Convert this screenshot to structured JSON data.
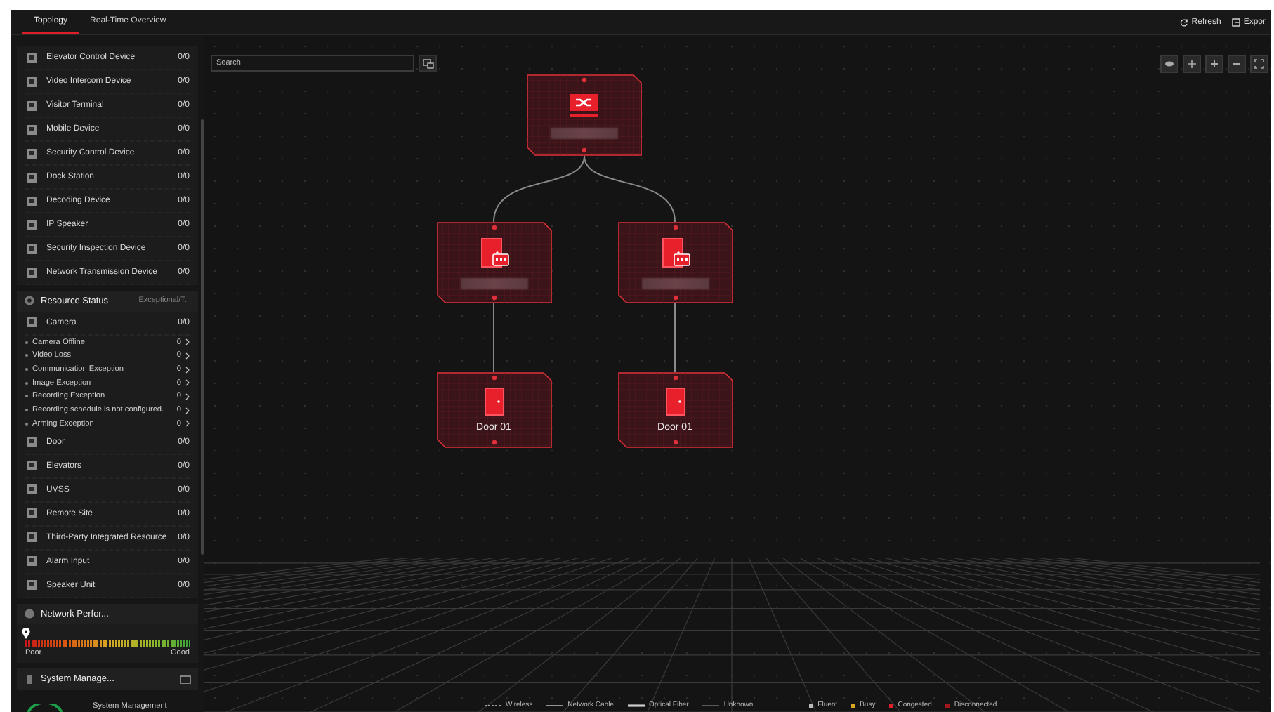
{
  "tabs": [
    {
      "label": "Topology",
      "selected": true
    },
    {
      "label": "Real-Time Overview",
      "selected": false
    }
  ],
  "actions": [
    {
      "kind": "refresh",
      "label": "Refresh"
    },
    {
      "kind": "export",
      "label": "Expor"
    }
  ],
  "device_list": [
    {
      "name": "Elevator Control Device",
      "count": "0/0"
    },
    {
      "name": "Video Intercom Device",
      "count": "0/0"
    },
    {
      "name": "Visitor Terminal",
      "count": "0/0"
    },
    {
      "name": "Mobile Device",
      "count": "0/0"
    },
    {
      "name": "Security Control Device",
      "count": "0/0"
    },
    {
      "name": "Dock Station",
      "count": "0/0"
    },
    {
      "name": "Decoding Device",
      "count": "0/0"
    },
    {
      "name": "IP Speaker",
      "count": "0/0"
    },
    {
      "name": "Security Inspection Device",
      "count": "0/0"
    },
    {
      "name": "Network Transmission Device",
      "count": "0/0"
    }
  ],
  "resource_status": {
    "title": "Resource Status",
    "filter": "Exceptional/T...",
    "items": [
      {
        "kind": "category",
        "name": "Camera",
        "count": "0/0"
      },
      {
        "kind": "exception",
        "name": "Camera Offline",
        "count": "0"
      },
      {
        "kind": "exception",
        "name": "Video Loss",
        "count": "0"
      },
      {
        "kind": "exception",
        "name": "Communication Exception",
        "count": "0"
      },
      {
        "kind": "exception",
        "name": "Image Exception",
        "count": "0"
      },
      {
        "kind": "exception",
        "name": "Recording Exception",
        "count": "0"
      },
      {
        "kind": "exception",
        "name": "Recording schedule is not configured.",
        "count": "0"
      },
      {
        "kind": "exception",
        "name": "Arming Exception",
        "count": "0"
      },
      {
        "kind": "category",
        "name": "Door",
        "count": "0/0"
      },
      {
        "kind": "category",
        "name": "Elevators",
        "count": "0/0"
      },
      {
        "kind": "category",
        "name": "UVSS",
        "count": "0/0"
      },
      {
        "kind": "category",
        "name": "Remote Site",
        "count": "0/0"
      },
      {
        "kind": "category",
        "name": "Third-Party Integrated Resource",
        "count": "0/0"
      },
      {
        "kind": "category",
        "name": "Alarm Input",
        "count": "0/0"
      },
      {
        "kind": "category",
        "name": "Speaker Unit",
        "count": "0/0"
      }
    ]
  },
  "network_performance": {
    "title": "Network Perfor...",
    "level": 0,
    "low": "Poor",
    "high": "Good"
  },
  "system_management": {
    "title": "System Manage...",
    "caption": "System Management"
  },
  "search": {
    "placeholder": "Search"
  },
  "topology": {
    "kind": "switch",
    "children": [
      {
        "kind": "intercom",
        "children": [
          {
            "kind": "door",
            "label": "Door 01"
          }
        ]
      },
      {
        "kind": "intercom",
        "children": [
          {
            "kind": "door",
            "label": "Door 01"
          }
        ]
      }
    ]
  },
  "legend": {
    "links": [
      {
        "kind": "wireless",
        "label": "Wireless"
      },
      {
        "kind": "cable",
        "label": "Network Cable"
      },
      {
        "kind": "fiber",
        "label": "Optical Fiber"
      },
      {
        "kind": "unknown",
        "label": "Unknown"
      }
    ],
    "statuses": [
      {
        "label": "Fluent",
        "color": "#b8b8b8"
      },
      {
        "label": "Busy",
        "color": "#d9a324"
      },
      {
        "label": "Congested",
        "color": "#e01e2a"
      },
      {
        "label": "Disconnected",
        "color": "#a3161d"
      }
    ]
  }
}
